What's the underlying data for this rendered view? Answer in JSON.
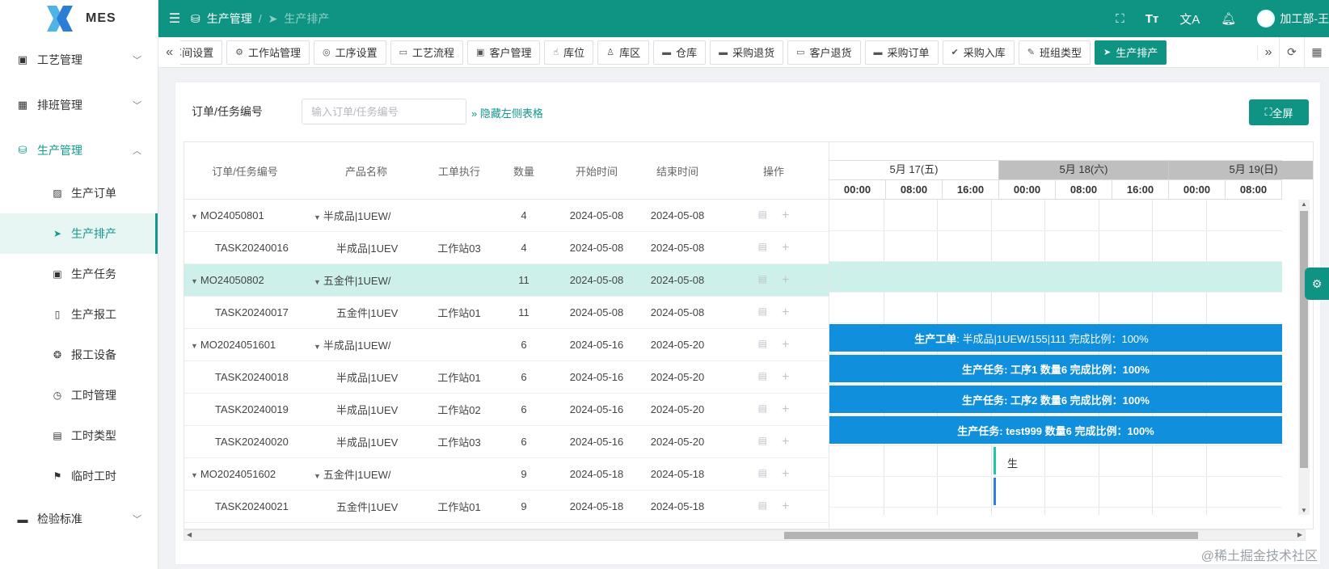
{
  "app": {
    "name": "MES"
  },
  "sidebar": {
    "items": [
      {
        "label": "工艺管理",
        "icon": "package-icon",
        "open": false
      },
      {
        "label": "排班管理",
        "icon": "calendar-icon",
        "open": false
      },
      {
        "label": "生产管理",
        "icon": "database-icon",
        "open": true
      }
    ],
    "sub_items": [
      {
        "label": "生产订单",
        "icon": "clipboard-icon"
      },
      {
        "label": "生产排产",
        "icon": "send-icon",
        "active": true
      },
      {
        "label": "生产任务",
        "icon": "box-icon"
      },
      {
        "label": "生产报工",
        "icon": "phone-icon"
      },
      {
        "label": "报工设备",
        "icon": "aperture-icon"
      },
      {
        "label": "工时管理",
        "icon": "clock-icon"
      },
      {
        "label": "工时类型",
        "icon": "document-icon"
      },
      {
        "label": "临时工时",
        "icon": "flag-icon"
      }
    ],
    "after_items": [
      {
        "label": "检验标准",
        "icon": "monitor-icon"
      }
    ]
  },
  "topbar": {
    "breadcrumb": [
      "生产管理",
      "生产排产"
    ],
    "separator": "/",
    "user": "加工部-王"
  },
  "tags": [
    {
      "label": "车间设置",
      "icon": "▤",
      "partial": true
    },
    {
      "label": "工作站管理",
      "icon": "⚙"
    },
    {
      "label": "工序设置",
      "icon": "◎"
    },
    {
      "label": "工艺流程",
      "icon": "▭"
    },
    {
      "label": "客户管理",
      "icon": "▣"
    },
    {
      "label": "库位",
      "icon": "☝"
    },
    {
      "label": "库区",
      "icon": "♙"
    },
    {
      "label": "仓库",
      "icon": "▬"
    },
    {
      "label": "采购退货",
      "icon": "▬"
    },
    {
      "label": "客户退货",
      "icon": "▭"
    },
    {
      "label": "采购订单",
      "icon": "▬"
    },
    {
      "label": "采购入库",
      "icon": "✔"
    },
    {
      "label": "班组类型",
      "icon": "✎"
    },
    {
      "label": "生产排产",
      "icon": "➤",
      "active": true
    }
  ],
  "search": {
    "label": "订单/任务编号",
    "placeholder": "输入订单/任务编号",
    "hide_link": "隐藏左侧表格",
    "fullscreen": "全屏"
  },
  "table": {
    "headers": [
      "订单/任务编号",
      "产品名称",
      "工单执行",
      "数量",
      "开始时间",
      "结束时间",
      "操作"
    ],
    "rows": [
      {
        "type": "parent",
        "code": "MO24050801",
        "product": "半成品|1UEW/",
        "station": "",
        "qty": "4",
        "start": "2024-05-08",
        "end": "2024-05-08"
      },
      {
        "type": "child",
        "code": "TASK20240016",
        "product": "半成品|1UEV",
        "station": "工作站03",
        "qty": "4",
        "start": "2024-05-08",
        "end": "2024-05-08"
      },
      {
        "type": "parent",
        "code": "MO24050802",
        "product": "五金件|1UEW/",
        "station": "",
        "qty": "11",
        "start": "2024-05-08",
        "end": "2024-05-08",
        "selected": true
      },
      {
        "type": "child",
        "code": "TASK20240017",
        "product": "五金件|1UEV",
        "station": "工作站01",
        "qty": "11",
        "start": "2024-05-08",
        "end": "2024-05-08"
      },
      {
        "type": "parent",
        "code": "MO2024051601",
        "product": "半成品|1UEW/",
        "station": "",
        "qty": "6",
        "start": "2024-05-16",
        "end": "2024-05-20"
      },
      {
        "type": "child",
        "code": "TASK20240018",
        "product": "半成品|1UEV",
        "station": "工作站01",
        "qty": "6",
        "start": "2024-05-16",
        "end": "2024-05-20"
      },
      {
        "type": "child",
        "code": "TASK20240019",
        "product": "半成品|1UEV",
        "station": "工作站02",
        "qty": "6",
        "start": "2024-05-16",
        "end": "2024-05-20"
      },
      {
        "type": "child",
        "code": "TASK20240020",
        "product": "半成品|1UEV",
        "station": "工作站03",
        "qty": "6",
        "start": "2024-05-16",
        "end": "2024-05-20"
      },
      {
        "type": "parent",
        "code": "MO2024051602",
        "product": "五金件|1UEW/",
        "station": "",
        "qty": "9",
        "start": "2024-05-18",
        "end": "2024-05-18"
      },
      {
        "type": "child",
        "code": "TASK20240021",
        "product": "五金件|1UEV",
        "station": "工作站01",
        "qty": "9",
        "start": "2024-05-18",
        "end": "2024-05-18"
      }
    ]
  },
  "gantt": {
    "days": [
      {
        "label": "5月 17(五)",
        "weekend": false
      },
      {
        "label": "5月 18(六)",
        "weekend": true
      },
      {
        "label": "5月 19(日)",
        "weekend": true
      }
    ],
    "hours": [
      "00:00",
      "08:00",
      "16:00",
      "00:00",
      "08:00",
      "16:00",
      "00:00",
      "08:00"
    ],
    "bars": [
      {
        "row": 4,
        "prefix": "生产工单",
        "text": ": 半成品|1UEW/155|111 完成比例：100%"
      },
      {
        "row": 5,
        "prefix": "生产任务",
        "text": ": 工序1 数量6 完成比例：100%"
      },
      {
        "row": 6,
        "prefix": "生产任务",
        "text": ": 工序2 数量6 完成比例：100%"
      },
      {
        "row": 7,
        "prefix": "生产任务",
        "text": ": test999 数量6 完成比例：100%"
      }
    ],
    "small_label": "生",
    "colors": {
      "bar": "#0f8fdc",
      "parent_marker": "#1ec8a5",
      "child_marker": "#2f7fe0"
    }
  },
  "watermark": "@稀土掘金技术社区",
  "colors": {
    "primary": "#0f9484",
    "selected_row": "#cdf0eb"
  }
}
